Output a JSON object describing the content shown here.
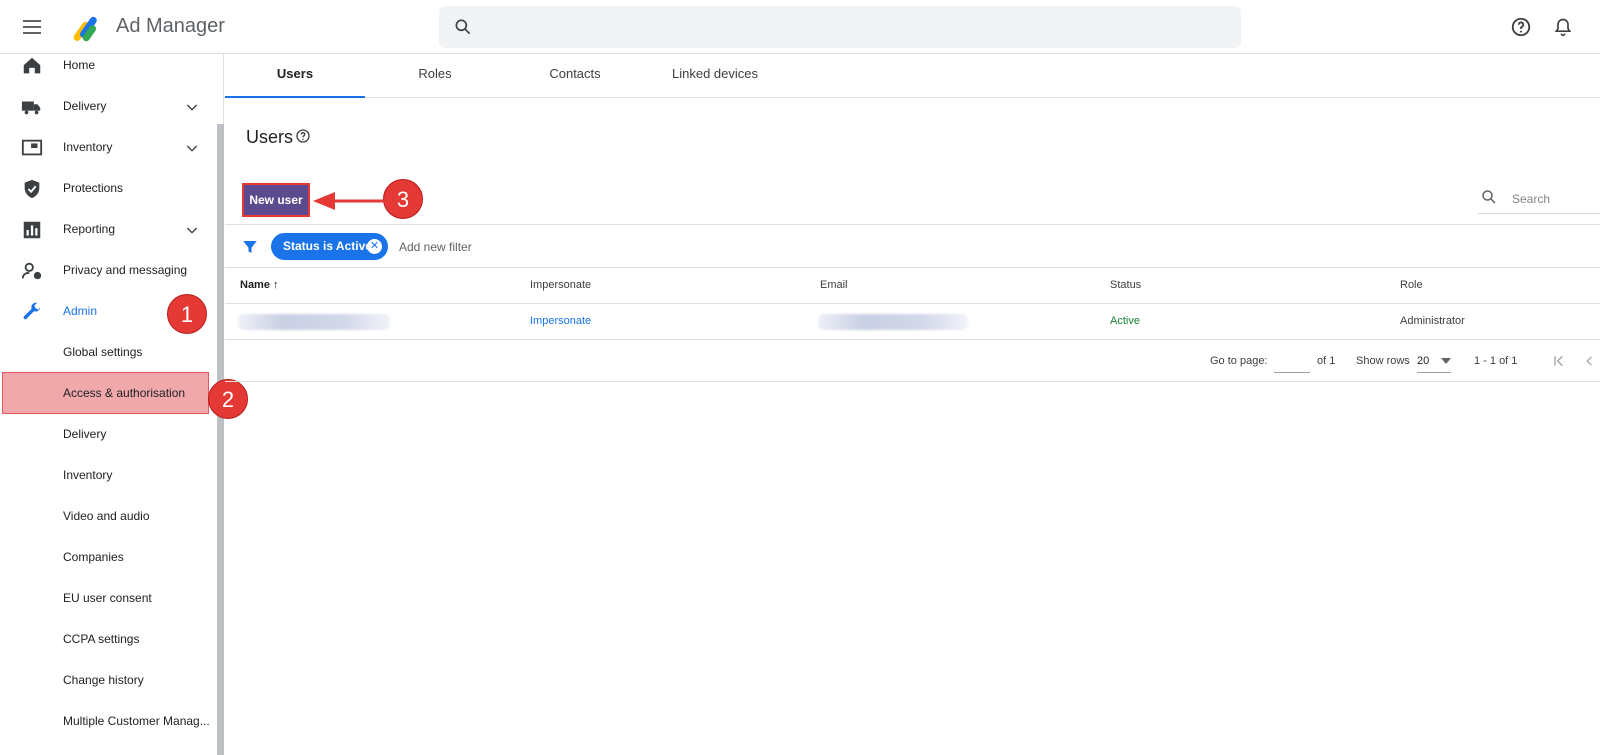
{
  "app": {
    "title": "Ad Manager"
  },
  "search": {
    "placeholder": ""
  },
  "sidebar": {
    "items": [
      {
        "label": "Home",
        "icon": "home-icon"
      },
      {
        "label": "Delivery",
        "icon": "truck-icon"
      },
      {
        "label": "Inventory",
        "icon": "inventory-icon"
      },
      {
        "label": "Protections",
        "icon": "shield-icon"
      },
      {
        "label": "Reporting",
        "icon": "bar-chart-icon"
      },
      {
        "label": "Privacy and messaging",
        "icon": "person-lock-icon"
      },
      {
        "label": "Admin",
        "icon": "wrench-icon"
      }
    ],
    "admin_children": [
      "Global settings",
      "Access & authorisation",
      "Delivery",
      "Inventory",
      "Video and audio",
      "Companies",
      "EU user consent",
      "CCPA settings",
      "Change history",
      "Multiple Customer Manag..."
    ]
  },
  "annotations": {
    "badge1": "1",
    "badge2": "2",
    "badge3": "3"
  },
  "tabs": [
    "Users",
    "Roles",
    "Contacts",
    "Linked devices"
  ],
  "main": {
    "title": "Users",
    "new_user_label": "New user",
    "search_placeholder": "Search",
    "filter": {
      "chip_label": "Status is Active",
      "add_filter_label": "Add new filter"
    },
    "columns": [
      "Name",
      "Impersonate",
      "Email",
      "Status",
      "Role"
    ],
    "rows": [
      {
        "name": "",
        "impersonate": "Impersonate",
        "email": "",
        "status": "Active",
        "role": "Administrator"
      }
    ],
    "pager": {
      "go_to_page": "Go to page:",
      "of_pages": "of 1",
      "show_rows": "Show rows",
      "rows_value": "20",
      "range": "1 - 1 of 1"
    }
  },
  "colors": {
    "accent": "#1a73e8",
    "new_user_bg": "#5c4a8f",
    "annotation_red": "#e53935",
    "highlight": "#f0a8aa"
  }
}
